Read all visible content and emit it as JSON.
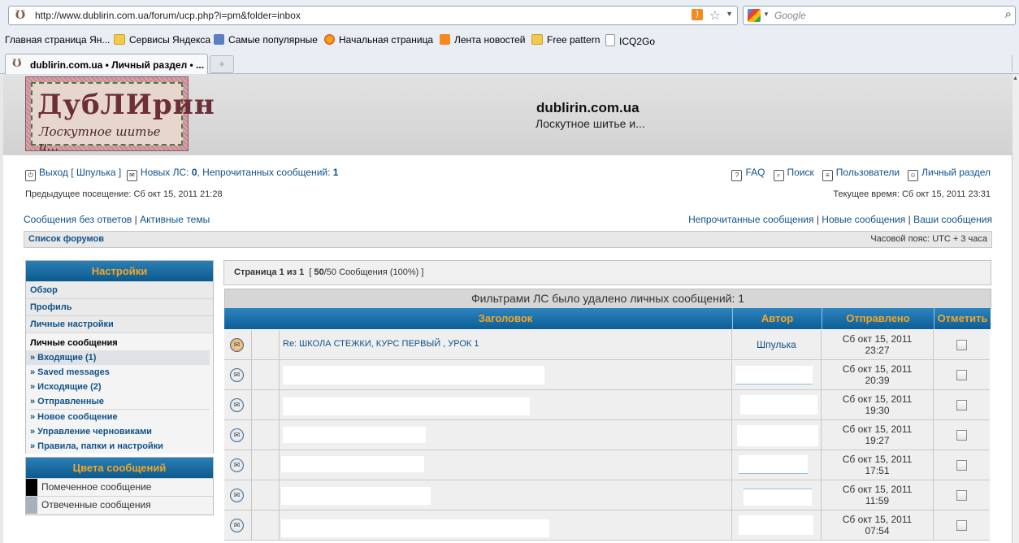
{
  "browser": {
    "url": "http://www.dublirin.com.ua/forum/ucp.php?i=pm&folder=inbox",
    "search_placeholder": "Google",
    "bookmarks": [
      "Главная страница Ян...",
      "Сервисы Яндекса",
      "Самые популярные",
      "Начальная страница",
      "Лента новостей",
      "Free pattern",
      "ICQ2Go"
    ],
    "tab_title": "dublirin.com.ua • Личный раздел • ...",
    "new_tab": "+"
  },
  "site": {
    "logo_line1": "ДубЛИрин",
    "logo_line2": "Лоскутное шитье и...",
    "title": "dublirin.com.ua",
    "description": "Лоскутное шитье и..."
  },
  "nav": {
    "logout": "Выход [ Шпулька ]",
    "new_pm_label": "Новых ЛС: ",
    "new_pm_count": "0",
    "unread_label": ", Непрочитанных сообщений: ",
    "unread_count": "1",
    "faq": "FAQ",
    "search": "Поиск",
    "members": "Пользователи",
    "ucp": "Личный раздел",
    "last_visit": "Предыдущее посещение: Сб окт 15, 2011 21:28",
    "current_time": "Текущее время: Сб окт 15, 2011 23:31",
    "unanswered": "Сообщения без ответов",
    "active": "Активные темы",
    "sep": "|",
    "unread_posts": "Непрочитанные сообщения",
    "new_posts": "Новые сообщения",
    "your_posts": "Ваши сообщения",
    "forum_index": "Список форумов",
    "timezone": "Часовой пояс: UTC + 3 часа"
  },
  "sidebar": {
    "settings_header": "Настройки",
    "items": [
      "Обзор",
      "Профиль",
      "Личные настройки"
    ],
    "pm_header": "Личные сообщения",
    "pm_items": [
      "» Входящие (1)",
      "» Saved messages",
      "» Исходящие (2)",
      "» Отправленные"
    ],
    "pm_actions": [
      "» Новое сообщение",
      "» Управление черновиками",
      "» Правила, папки и настройки"
    ],
    "colors_header": "Цвета сообщений",
    "legend": [
      {
        "label": "Помеченное сообщение",
        "color": "#000000"
      },
      {
        "label": "Отвеченные сообщения",
        "color": "#a7b1ba"
      }
    ]
  },
  "main": {
    "page_label": "Страница ",
    "page_current": "1",
    "page_of": " из ",
    "page_total": "1",
    "count_open": "  [ ",
    "count_value": "50",
    "count_rest": "/50 Сообщения (100%) ]",
    "filter_notice": "Фильтрами ЛС было удалено личных сообщений: 1",
    "columns": [
      "Заголовок",
      "Автор",
      "Отправлено",
      "Отметить"
    ],
    "rows": [
      {
        "title": "Re: ШКОЛА СТЕЖКИ, КУРС ПЕРВЫЙ , УРОК 1",
        "author": "Шпулька",
        "date": "Сб окт 15, 2011",
        "time": "23:27",
        "unread": true
      },
      {
        "title": "",
        "author": "",
        "date": "Сб окт 15, 2011",
        "time": "20:39",
        "unread": false
      },
      {
        "title": "",
        "author": "",
        "date": "Сб окт 15, 2011",
        "time": "19:30",
        "unread": false
      },
      {
        "title": "",
        "author": "",
        "date": "Сб окт 15, 2011",
        "time": "19:27",
        "unread": false
      },
      {
        "title": "",
        "author": "",
        "date": "Сб окт 15, 2011",
        "time": "17:51",
        "unread": false
      },
      {
        "title": "",
        "author": "",
        "date": "Сб окт 15, 2011",
        "time": "11:59",
        "unread": false
      },
      {
        "title": "",
        "author": "",
        "date": "Сб окт 15, 2011",
        "time": "07:54",
        "unread": false
      }
    ]
  },
  "colors": {
    "accent": "#f5a623",
    "link": "#105289",
    "header_blue": "#0d5e96"
  }
}
